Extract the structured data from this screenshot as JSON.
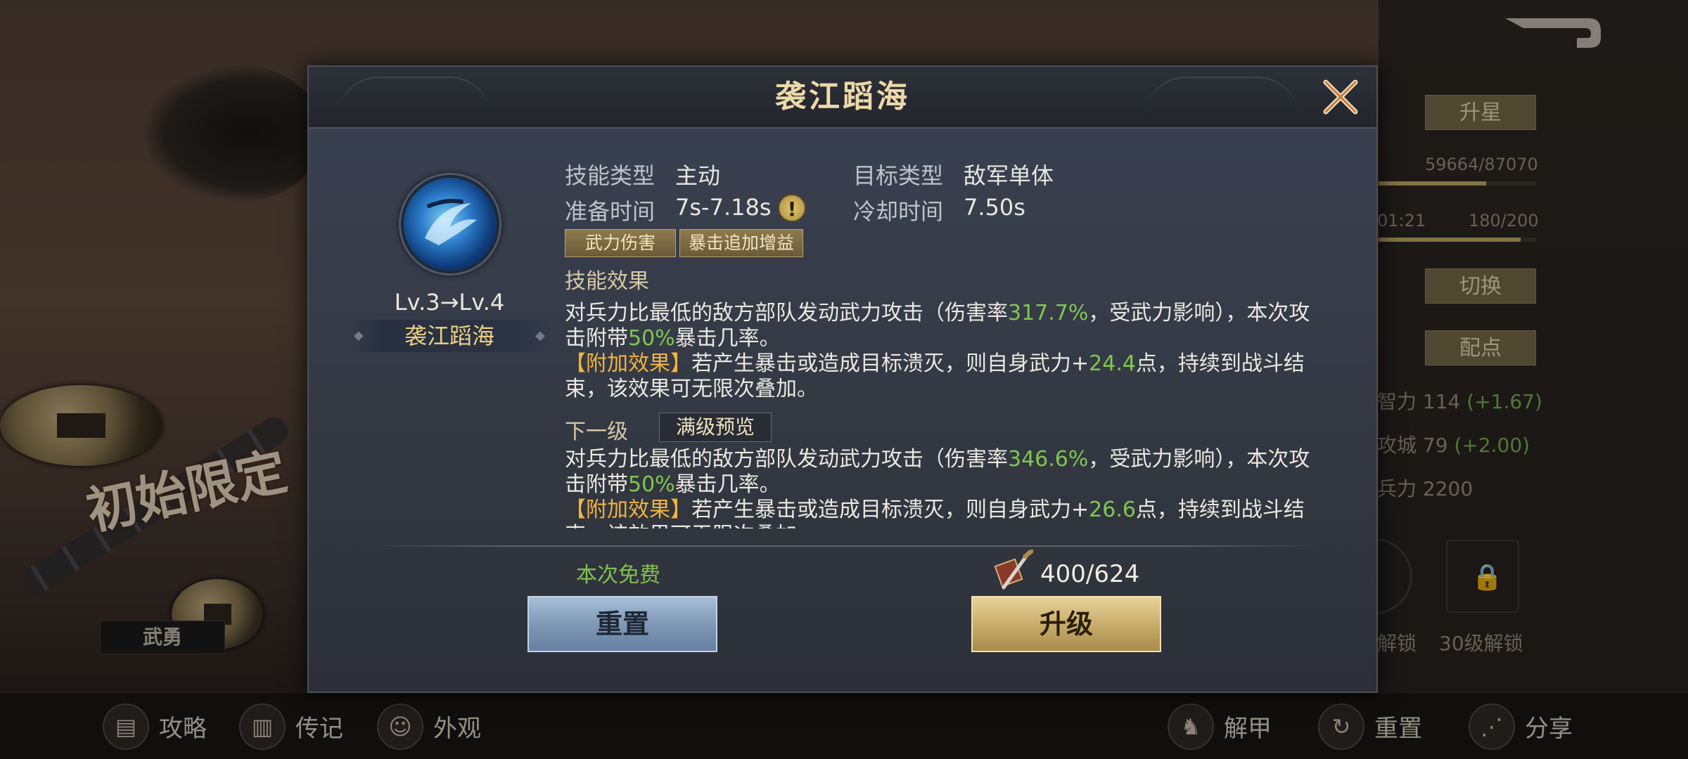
{
  "background": {
    "calligraphy": "初始限定",
    "tag_label": "武勇"
  },
  "right_panel": {
    "star_button": "升星",
    "exp_progress": "59664/87070",
    "exp_fraction": 0.685,
    "timer": "01:21",
    "stamina": "180/200",
    "stamina_fraction": 0.9,
    "switch_button": "切换",
    "assign_button": "配点",
    "stats": [
      {
        "label": "智力 114",
        "bonus": "(+1.67)"
      },
      {
        "label": "攻城 79",
        "bonus": "(+2.00)"
      },
      {
        "label": "兵力 2200",
        "bonus": ""
      }
    ],
    "unlock_left": "解锁",
    "unlock_right": "30级解锁"
  },
  "bottom_bar": {
    "items": [
      {
        "label": "攻略",
        "icon": "book-icon"
      },
      {
        "label": "传记",
        "icon": "scroll-icon"
      },
      {
        "label": "外观",
        "icon": "face-icon"
      },
      {
        "label": "解甲",
        "icon": "armor-icon"
      },
      {
        "label": "重置",
        "icon": "reset-icon"
      },
      {
        "label": "分享",
        "icon": "share-icon"
      }
    ]
  },
  "modal": {
    "title": "袭江蹈海",
    "level_text": "Lv.3→Lv.4",
    "skill_name": "袭江蹈海",
    "info": {
      "skill_type_label": "技能类型",
      "skill_type_value": "主动",
      "target_type_label": "目标类型",
      "target_type_value": "敌军单体",
      "prep_time_label": "准备时间",
      "prep_time_value": "7s-7.18s",
      "cooldown_label": "冷却时间",
      "cooldown_value": "7.50s",
      "warn_glyph": "!"
    },
    "tags": [
      "武力伤害",
      "暴击追加增益"
    ],
    "effect_label": "技能效果",
    "current_effect": {
      "p1_a": "对兵力比最低的敌方部队发动武力攻击（伤害率",
      "p1_rate": "317.7%",
      "p1_b": "，受武力影响），本次攻击附带",
      "p1_crit": "50%",
      "p1_c": "暴击几率。",
      "p2_tag": "【附加效果】",
      "p2_a": "若产生暴击或造成目标溃灭，则自身武力+",
      "p2_val": "24.4",
      "p2_b": "点，持续到战斗结束，该效果可无限次叠加。"
    },
    "next_level_label": "下一级",
    "max_preview_button": "满级预览",
    "next_effect": {
      "p1_a": "对兵力比最低的敌方部队发动武力攻击（伤害率",
      "p1_rate": "346.6%",
      "p1_b": "，受武力影响），本次攻击附带",
      "p1_crit": "50%",
      "p1_c": "暴击几率。",
      "p2_tag": "【附加效果】",
      "p2_a": "若产生暴击或造成目标溃灭，则自身武力+",
      "p2_val": "26.6",
      "p2_b": "点，持续到战斗结束，该效果可无限次叠加。"
    },
    "free_text": "本次免费",
    "cost": "400/624",
    "reset_button": "重置",
    "upgrade_button": "升级"
  }
}
